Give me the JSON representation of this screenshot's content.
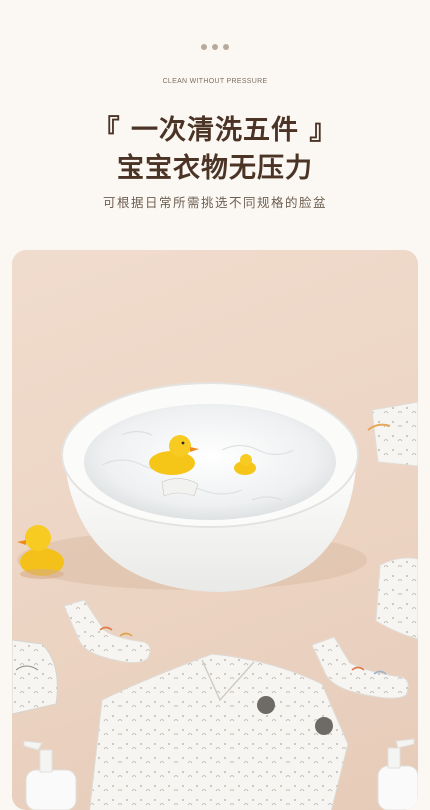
{
  "header": {
    "dots": [
      "dot",
      "dot",
      "dot"
    ],
    "eyebrow": "CLEAN WITHOUT PRESSURE",
    "title_line1": "『 一次清洗五件 』",
    "title_line2": "宝宝衣物无压力",
    "subtitle": "可根据日常所需挑选不同规格的脸盆"
  },
  "photo": {
    "subject": "white-wash-basin-with-rubber-ducks-and-baby-clothes"
  },
  "colors": {
    "page_bg": "#fbf8f3",
    "title": "#4b3426",
    "subtitle": "#6d5f52",
    "photo_bg": "#ecd4c3",
    "duck": "#f5c518"
  }
}
